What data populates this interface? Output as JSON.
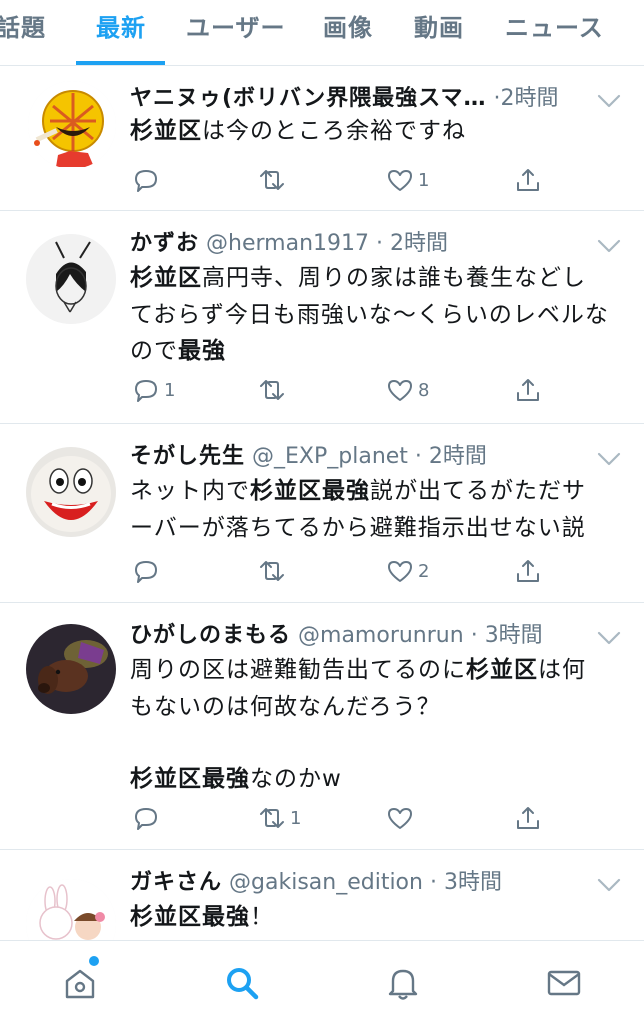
{
  "tabs": [
    {
      "label": "話題"
    },
    {
      "label": "最新"
    },
    {
      "label": "ユーザー"
    },
    {
      "label": "画像"
    },
    {
      "label": "動画"
    },
    {
      "label": "ニュース"
    }
  ],
  "active_tab": "最新",
  "tweets": [
    {
      "name": "ヤニヌゥ(ボリバン界隈最強スマ…",
      "handle": "",
      "dot": "·",
      "time": "2時間",
      "body": [
        [
          {
            "t": "杉並区",
            "b": true
          },
          {
            "t": "は今のところ余裕ですね",
            "b": false
          }
        ]
      ],
      "counts": {
        "reply": "",
        "retweet": "",
        "like": "1"
      },
      "avatar_icon": "cartoon-avatar-icon"
    },
    {
      "name": "かずお",
      "handle": "@herman1917",
      "dot": "·",
      "time": "2時間",
      "body": [
        [
          {
            "t": "杉並区",
            "b": true
          },
          {
            "t": "高円寺、周りの家は誰も養生などし",
            "b": false
          }
        ],
        [
          {
            "t": "ておらず今日も雨強いな〜くらいのレベルな",
            "b": false
          }
        ],
        [
          {
            "t": "ので",
            "b": false
          },
          {
            "t": "最強",
            "b": true
          }
        ]
      ],
      "counts": {
        "reply": "1",
        "retweet": "",
        "like": "8"
      },
      "avatar_icon": "sketch-avatar-icon"
    },
    {
      "name": "そがし先生",
      "handle": "@_EXP_planet",
      "dot": "·",
      "time": "2時間",
      "body": [
        [
          {
            "t": "ネット内で",
            "b": false
          },
          {
            "t": "杉並区最強",
            "b": true
          },
          {
            "t": "説が出てるがただサ",
            "b": false
          }
        ],
        [
          {
            "t": "ーバーが落ちてるから避難指示出せない説",
            "b": false
          }
        ]
      ],
      "counts": {
        "reply": "",
        "retweet": "",
        "like": "2"
      },
      "avatar_icon": "smiley-face-avatar-icon"
    },
    {
      "name": "ひがしのまもる",
      "handle": "@mamorunrun",
      "dot": "·",
      "time": "3時間",
      "body": [
        [
          {
            "t": "周りの区は避難勧告出てるのに",
            "b": false
          },
          {
            "t": "杉並区",
            "b": true
          },
          {
            "t": "は何",
            "b": false
          }
        ],
        [
          {
            "t": "もないのは何故なんだろう？",
            "b": false
          }
        ],
        [
          {
            "t": "杉並区最強",
            "b": true
          },
          {
            "t": "なのかw",
            "b": false
          }
        ]
      ],
      "counts": {
        "reply": "",
        "retweet": "1",
        "like": ""
      },
      "avatar_icon": "dog-photo-avatar-icon"
    },
    {
      "name": "ガキさん",
      "handle": "@gakisan_edition",
      "dot": "·",
      "time": "3時間",
      "body": [
        [
          {
            "t": "杉並区最強",
            "b": true
          },
          {
            "t": "！",
            "b": false
          }
        ]
      ],
      "counts": {
        "reply": "",
        "retweet": "",
        "like": ""
      },
      "avatar_icon": "bunny-avatar-icon"
    }
  ],
  "bottom_nav": [
    {
      "icon": "home-icon",
      "has_dot": true
    },
    {
      "icon": "search-icon",
      "active": true
    },
    {
      "icon": "bell-icon"
    },
    {
      "icon": "mail-icon"
    }
  ],
  "colors": {
    "accent": "#1da1f2",
    "text": "#14171a",
    "muted": "#657786",
    "divider": "#e1e8ed"
  }
}
